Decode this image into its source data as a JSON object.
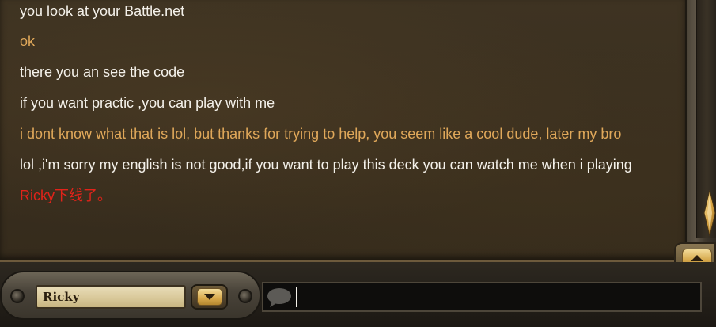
{
  "chat": {
    "messages": [
      {
        "text": "you look at your Battle.net",
        "color": "#f4f1ea"
      },
      {
        "text": "ok",
        "color": "#e0a85a"
      },
      {
        "text": "there you an see the code",
        "color": "#f4f1ea"
      },
      {
        "text": "if you want practic ,you can play with me",
        "color": "#f4f1ea"
      },
      {
        "text": "i dont know what that is lol, but thanks for trying to help, you seem like a cool dude, later my bro",
        "color": "#e0a85a"
      },
      {
        "text": "lol ,i'm sorry my english is not good,if you want to play this deck you can watch me when i playing",
        "color": "#f4f1ea"
      },
      {
        "text": "Ricky下线了。",
        "color": "#e2231a"
      }
    ]
  },
  "recipient": {
    "name": "Ricky"
  },
  "input": {
    "value": "",
    "placeholder": ""
  },
  "icons": {
    "scroll_up": "chevron-up-icon",
    "dropdown": "chevron-down-icon",
    "chat": "speech-bubble-icon"
  }
}
